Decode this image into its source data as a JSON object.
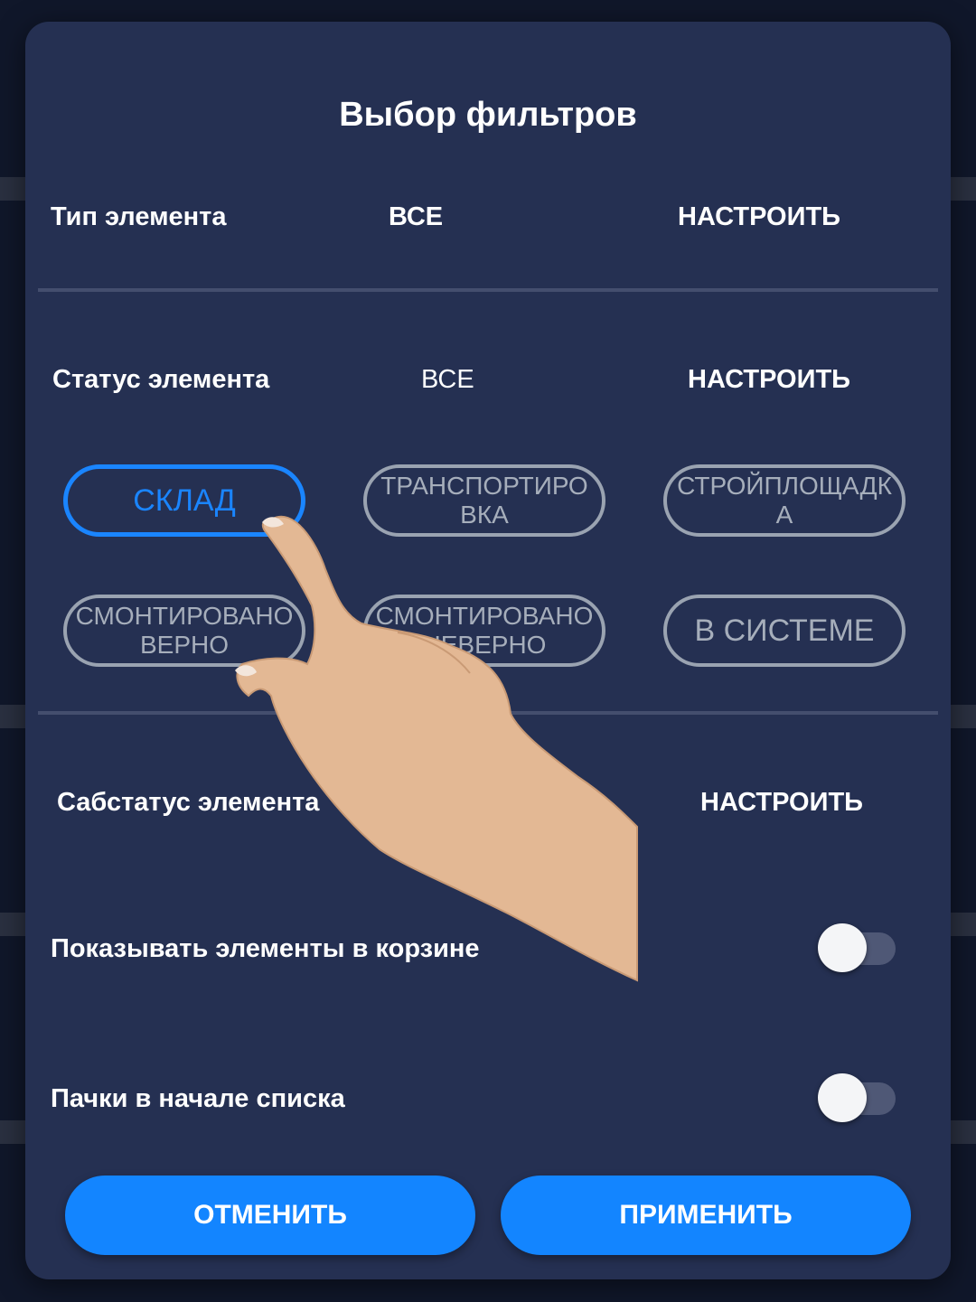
{
  "dialog": {
    "title": "Выбор фильтров",
    "rows": {
      "type": {
        "label": "Тип элемента",
        "value": "ВСЕ",
        "action": "НАСТРОИТЬ"
      },
      "status": {
        "label": "Статус элемента",
        "value": "ВСЕ",
        "action": "НАСТРОИТЬ"
      },
      "substatus": {
        "label": "Сабстатус элемента",
        "action": "НАСТРОИТЬ"
      }
    },
    "status_chips": [
      {
        "label": "СКЛАД",
        "selected": true
      },
      {
        "label": "ТРАНСПОРТИРОВКА",
        "selected": false
      },
      {
        "label": "СТРОЙПЛОЩАДКА",
        "selected": false
      },
      {
        "label": "СМОНТИРОВАНО ВЕРНО",
        "selected": false
      },
      {
        "label": "СМОНТИРОВАНО НЕВЕРНО",
        "selected": false
      },
      {
        "label": "В СИСТЕМЕ",
        "selected": false
      }
    ],
    "toggles": {
      "show_in_trash": {
        "label": "Показывать элементы в корзине",
        "on": false
      },
      "bundles_first": {
        "label": "Пачки в начале списка",
        "on": false
      }
    },
    "buttons": {
      "cancel": "ОТМЕНИТЬ",
      "apply": "ПРИМЕНИТЬ"
    }
  },
  "colors": {
    "dialog_bg": "#253052",
    "accent": "#1385ff",
    "chip_border": "#9aa3b1",
    "divider": "#444e6e"
  }
}
